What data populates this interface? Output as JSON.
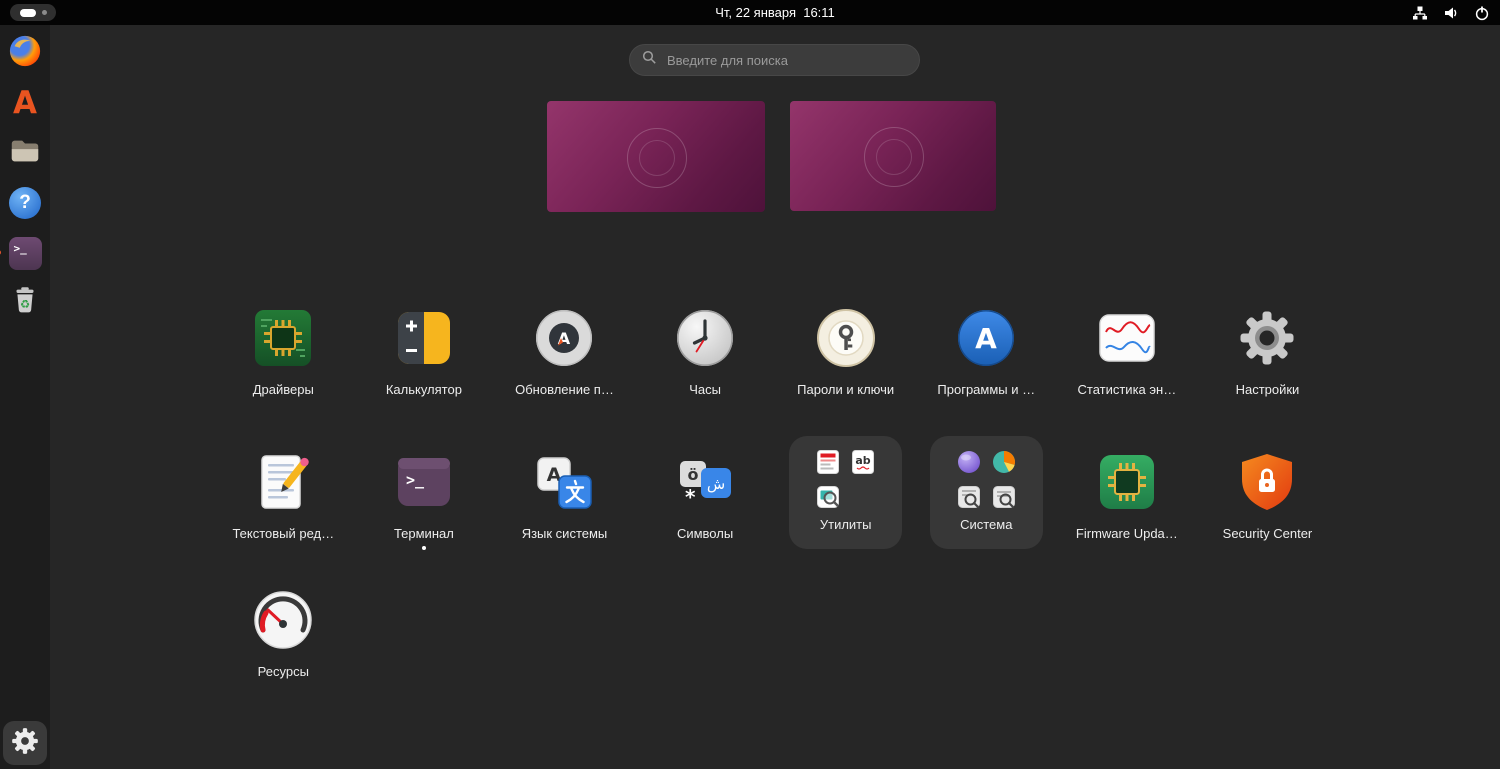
{
  "topbar": {
    "clock": "Чт, 22 января  16:11",
    "tray": [
      "network",
      "volume",
      "power"
    ],
    "workspace_switcher": {
      "workspaces": 2,
      "active": 1
    }
  },
  "search": {
    "placeholder": "Введите для поиска"
  },
  "dock": {
    "items": [
      "firefox",
      "app-center",
      "files",
      "help",
      "terminal",
      "trash"
    ],
    "terminal_running": true,
    "show_apps": "show-applications"
  },
  "workspaces": {
    "count": 2
  },
  "glyphs": {
    "prompt": ">_",
    "prompt_small": ">_",
    "help": "?",
    "appcenter_a": "A",
    "updater_a": "A",
    "store_a": "A",
    "lang_a": "A",
    "symbols_o": "ö",
    "symbols_ar": "ش",
    "symbols_star": "*",
    "mini_ab": "ab",
    "recycle": "♻"
  },
  "colors": {
    "accent_orange": "#e95420",
    "folder_bg": "#373737",
    "selection_blue": "#3584e4"
  },
  "apps": {
    "row1": [
      {
        "label": "Драйверы",
        "icon": "drivers"
      },
      {
        "label": "Калькулятор",
        "icon": "calculator"
      },
      {
        "label": "Обновление п…",
        "icon": "software-updater"
      },
      {
        "label": "Часы",
        "icon": "clocks"
      },
      {
        "label": "Пароли и ключи",
        "icon": "passwords-keys"
      },
      {
        "label": "Программы и …",
        "icon": "app-store"
      },
      {
        "label": "Статистика эн…",
        "icon": "power-statistics"
      },
      {
        "label": "Настройки",
        "icon": "settings"
      }
    ],
    "row2": [
      {
        "label": "Текстовый ред…",
        "icon": "text-editor"
      },
      {
        "label": "Терминал",
        "icon": "terminal",
        "running": true
      },
      {
        "label": "Язык системы",
        "icon": "language"
      },
      {
        "label": "Символы",
        "icon": "characters"
      },
      {
        "label": "Утилиты",
        "icon": "folder-utilities",
        "folder": true
      },
      {
        "label": "Система",
        "icon": "folder-system",
        "folder": true
      },
      {
        "label": "Firmware Upda…",
        "icon": "firmware-updater"
      },
      {
        "label": "Security Center",
        "icon": "security-center"
      }
    ],
    "row3": [
      {
        "label": "Ресурсы",
        "icon": "resources"
      }
    ]
  }
}
